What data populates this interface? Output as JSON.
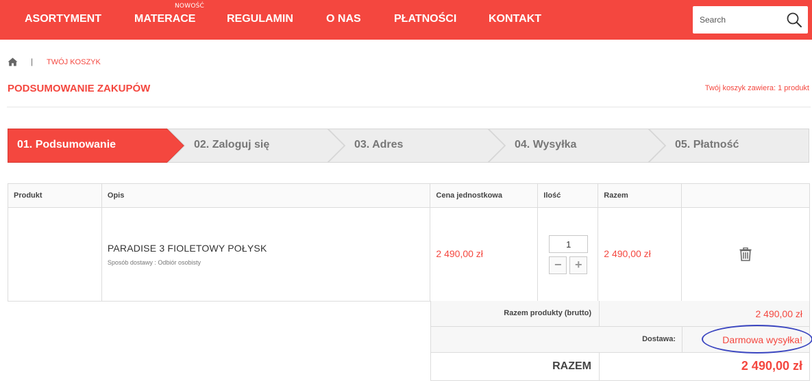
{
  "nav": {
    "items": [
      {
        "label": "ASORTYMENT"
      },
      {
        "label": "MATERACE",
        "badge": "NOWOŚĆ"
      },
      {
        "label": "REGULAMIN"
      },
      {
        "label": "O NAS"
      },
      {
        "label": "PŁATNOŚCI"
      },
      {
        "label": "KONTAKT"
      }
    ],
    "search_placeholder": "Search",
    "search_icon": "magnifier-icon"
  },
  "breadcrumb": {
    "home_icon": "home-icon",
    "separator": "|",
    "current": "TWÓJ KOSZYK"
  },
  "header": {
    "title": "PODSUMOWANIE ZAKUPÓW",
    "cart_summary": "Twój koszyk zawiera: 1 produkt"
  },
  "steps": [
    {
      "label": "01. Podsumowanie",
      "active": true
    },
    {
      "label": "02. Zaloguj się",
      "active": false
    },
    {
      "label": "03. Adres",
      "active": false
    },
    {
      "label": "04. Wysyłka",
      "active": false
    },
    {
      "label": "05. Płatność",
      "active": false
    }
  ],
  "table": {
    "headers": [
      "Produkt",
      "Opis",
      "Cena jednostkowa",
      "Ilość",
      "Razem",
      ""
    ],
    "row": {
      "name": "PARADISE 3 FIOLETOWY POŁYSK",
      "delivery": "Sposób dostawy : Odbiór osobisty",
      "unit_price": "2 490,00 zł",
      "quantity": "1",
      "total": "2 490,00 zł",
      "delete_icon": "trash-icon"
    }
  },
  "totals": {
    "products_label": "Razem produkty (brutto)",
    "products_value": "2 490,00 zł",
    "shipping_label": "Dostawa:",
    "shipping_value": "Darmowa wysyłka!",
    "total_label": "RAZEM",
    "total_value": "2 490,00 zł"
  },
  "colors": {
    "accent": "#f4473f",
    "annotation": "#3a45c0"
  }
}
